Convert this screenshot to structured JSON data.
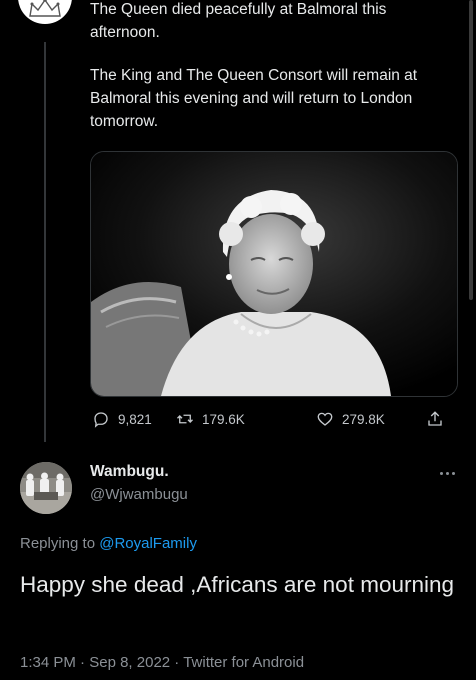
{
  "parent_tweet": {
    "paragraphs": [
      "The Queen died peacefully at Balmoral this afternoon.",
      "The King and The Queen Consort will remain at Balmoral this evening and will return to London tomorrow."
    ],
    "stats": {
      "replies": "9,821",
      "retweets": "179.6K",
      "likes": "279.8K"
    },
    "icons": [
      "reply-icon",
      "retweet-icon",
      "like-icon",
      "share-icon"
    ]
  },
  "reply_tweet": {
    "display_name": "Wambugu.",
    "handle": "@Wjwambugu",
    "replying_prefix": "Replying to ",
    "replying_to": "@RoyalFamily",
    "text": "Happy she dead ,Africans are not mourning",
    "time": "1:34 PM",
    "date": "Sep 8, 2022",
    "source": "Twitter for Android",
    "separator": " · "
  },
  "colors": {
    "background": "#000000",
    "text": "#e7e9ea",
    "muted": "#8b9096",
    "accent": "#1d9bf0"
  }
}
